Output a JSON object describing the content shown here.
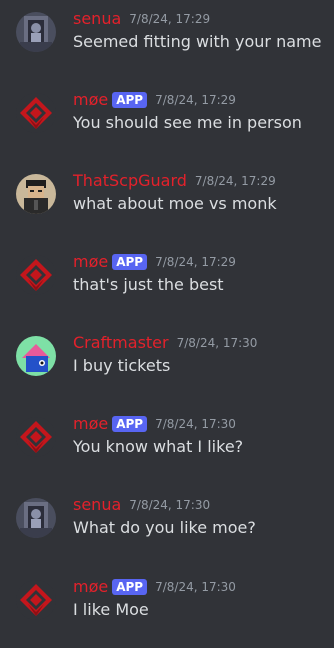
{
  "colors": {
    "background": "#313338",
    "username": "#e3212b",
    "app_badge": "#5865f2",
    "timestamp": "#949ba4",
    "message_text": "#dbdee1"
  },
  "messages": [
    {
      "avatar": "senua-avatar",
      "username": "senua",
      "badge": "",
      "timestamp": "7/8/24, 17:29",
      "text": "Seemed fitting with your name"
    },
    {
      "avatar": "moe-logo-avatar",
      "username": "møe",
      "badge": "APP",
      "timestamp": "7/8/24, 17:29",
      "text": "You should see me in person"
    },
    {
      "avatar": "scp-guard-avatar",
      "username": "ThatScpGuard",
      "badge": "",
      "timestamp": "7/8/24, 17:29",
      "text": "what about moe vs monk"
    },
    {
      "avatar": "moe-logo-avatar",
      "username": "møe",
      "badge": "APP",
      "timestamp": "7/8/24, 17:29",
      "text": "that's just the best"
    },
    {
      "avatar": "craftmaster-avatar",
      "username": "Craftmaster",
      "badge": "",
      "timestamp": "7/8/24, 17:30",
      "text": "I buy tickets"
    },
    {
      "avatar": "moe-logo-avatar",
      "username": "møe",
      "badge": "APP",
      "timestamp": "7/8/24, 17:30",
      "text": "You know what I like?"
    },
    {
      "avatar": "senua-avatar",
      "username": "senua",
      "badge": "",
      "timestamp": "7/8/24, 17:30",
      "text": "What do you like moe?"
    },
    {
      "avatar": "moe-logo-avatar",
      "username": "møe",
      "badge": "APP",
      "timestamp": "7/8/24, 17:30",
      "text": "I like Moe"
    }
  ]
}
